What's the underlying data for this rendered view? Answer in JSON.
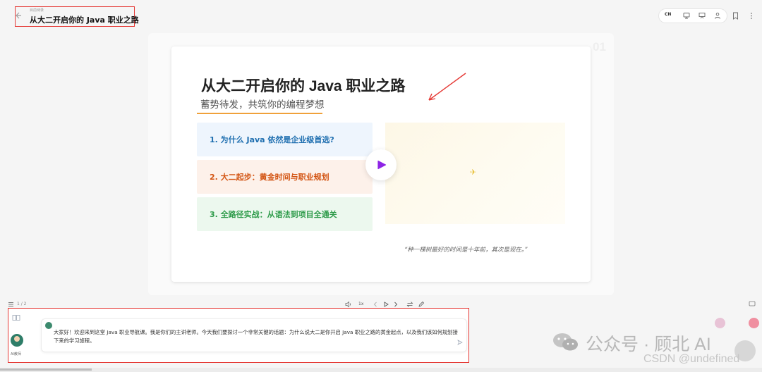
{
  "header": {
    "breadcrumb": "目前待录",
    "title": "从大二开启你的 Java 职业之路",
    "language_toggle": "CN",
    "tools": [
      "monitor-icon",
      "presentation-icon",
      "person-icon",
      "bookmark-icon",
      "more-icon"
    ]
  },
  "slide": {
    "number": "01",
    "title": "从大二开启你的 Java 职业之路",
    "subtitle": "蓄势待发，共筑你的编程梦想",
    "items": [
      {
        "label": "1. 为什么 Java 依然是企业级首选?",
        "color": "#1f6fb0"
      },
      {
        "label": "2. 大二起步：黄金时间与职业规划",
        "color": "#d35412"
      },
      {
        "label": "3. 全路径实战：从语法到项目全通关",
        "color": "#2e9b4a"
      }
    ],
    "quote": "“种一棵树最好的时间是十年前，其次是现在。”",
    "accent_color": "#f0a13a",
    "play_color": "#8e24e6"
  },
  "controls": {
    "page_indicator": "1 / 2",
    "speed": "1x"
  },
  "assistant": {
    "label": "AI教师",
    "message": "大家好！欢迎来到这堂 Java 职业导航课。我是你们的主讲老师。今天我们要探讨一个非常关键的话题：为什么说大二是你开启 Java 职业之路的黄金起点，以及我们该如何规划接下来的学习旅程。"
  },
  "watermark": {
    "wechat": "公众号 · 顾北 AI",
    "csdn": "CSDN @undefined"
  },
  "annotation_color": "#e53935"
}
